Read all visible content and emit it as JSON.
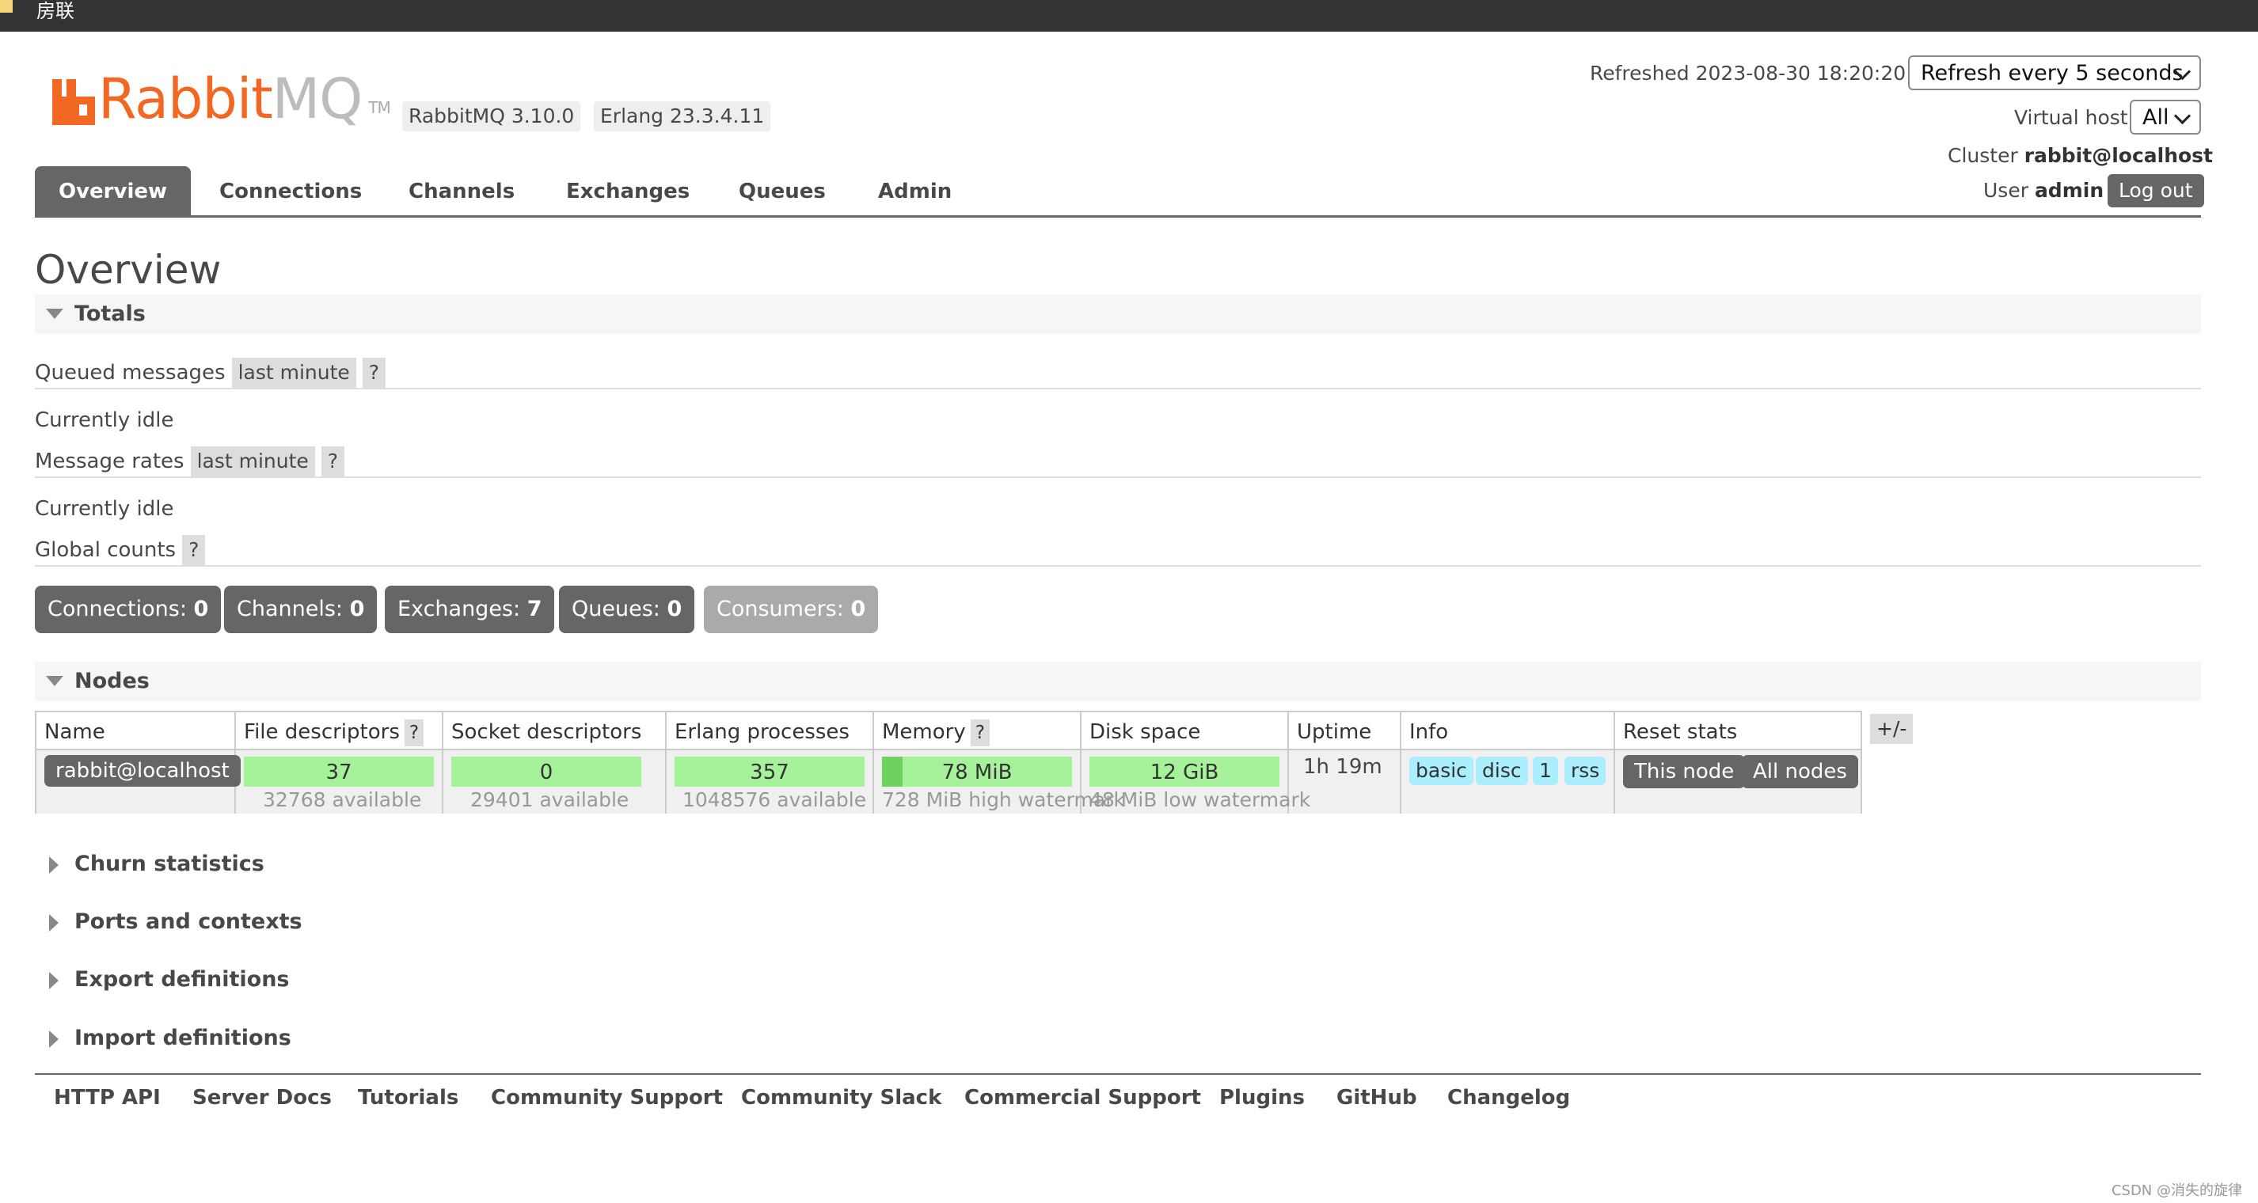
{
  "window": {
    "title": "房联"
  },
  "header": {
    "logo_word_rabbit": "Rabbit",
    "logo_word_mq": "MQ",
    "logo_tm": "TM",
    "rabbitmq_version": "RabbitMQ 3.10.0",
    "erlang_version": "Erlang 23.3.4.11",
    "refreshed_label": "Refreshed",
    "refreshed_time": "2023-08-30 18:20:20",
    "refresh_select": "Refresh every 5 seconds",
    "vhost_label": "Virtual host",
    "vhost_select": "All",
    "cluster_label": "Cluster",
    "cluster_name": "rabbit@localhost",
    "user_label": "User",
    "user_name": "admin",
    "logout_label": "Log out"
  },
  "tabs": [
    "Overview",
    "Connections",
    "Channels",
    "Exchanges",
    "Queues",
    "Admin"
  ],
  "page_title": "Overview",
  "totals": {
    "section_label": "Totals",
    "queued_messages_label": "Queued messages",
    "queued_range": "last minute",
    "help": "?",
    "idle_1": "Currently idle",
    "message_rates_label": "Message rates",
    "rates_range": "last minute",
    "idle_2": "Currently idle",
    "global_counts_label": "Global counts",
    "counts": {
      "connections_label": "Connections:",
      "connections": "0",
      "channels_label": "Channels:",
      "channels": "0",
      "exchanges_label": "Exchanges:",
      "exchanges": "7",
      "queues_label": "Queues:",
      "queues": "0",
      "consumers_label": "Consumers:",
      "consumers": "0"
    }
  },
  "nodes": {
    "section_label": "Nodes",
    "columns": [
      "Name",
      "File descriptors",
      "Socket descriptors",
      "Erlang processes",
      "Memory",
      "Disk space",
      "Uptime",
      "Info",
      "Reset stats"
    ],
    "help": "?",
    "plus_minus": "+/-",
    "row": {
      "name": "rabbit@localhost",
      "file_descriptors": "37",
      "file_descriptors_available": "32768 available",
      "socket_descriptors": "0",
      "socket_descriptors_available": "29401 available",
      "erlang_processes": "357",
      "erlang_processes_available": "1048576 available",
      "memory": "78 MiB",
      "memory_watermark": "728 MiB high watermark",
      "memory_fraction": 0.11,
      "disk_space": "12 GiB",
      "disk_watermark": "48 MiB low watermark",
      "uptime": "1h 19m",
      "info_tags": [
        "basic",
        "disc",
        "1",
        "rss"
      ],
      "reset_this": "This node",
      "reset_all": "All nodes"
    }
  },
  "collapsed_sections": [
    "Churn statistics",
    "Ports and contexts",
    "Export definitions",
    "Import definitions"
  ],
  "footer_links": [
    "HTTP API",
    "Server Docs",
    "Tutorials",
    "Community Support",
    "Community Slack",
    "Commercial Support",
    "Plugins",
    "GitHub",
    "Changelog"
  ],
  "watermark": "CSDN @消失的旋律",
  "colors": {
    "brand_orange": "#f26722",
    "bar_green": "#a6f29a",
    "tab_gray": "#666666",
    "info_blue": "#aaeeff"
  }
}
